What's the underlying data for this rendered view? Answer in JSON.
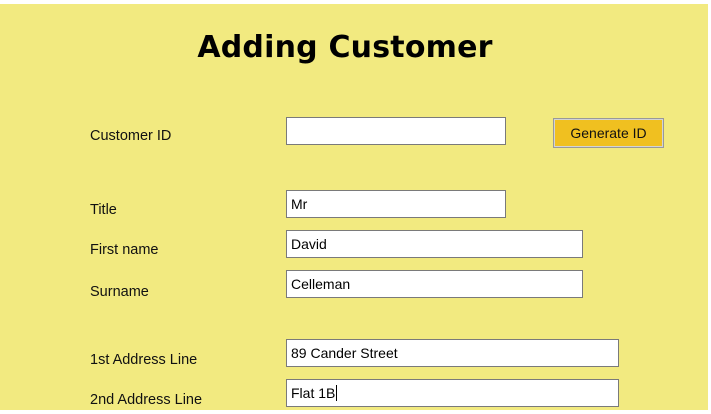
{
  "form": {
    "title": "Adding Customer",
    "generate_button_label": "Generate ID",
    "fields": {
      "customer_id": {
        "label": "Customer ID",
        "value": ""
      },
      "title": {
        "label": "Title",
        "value": "Mr"
      },
      "first_name": {
        "label": "First name",
        "value": "David"
      },
      "surname": {
        "label": "Surname",
        "value": "Celleman"
      },
      "address_line_1": {
        "label": "1st Address Line",
        "value": "89 Cander Street"
      },
      "address_line_2": {
        "label": "2nd Address Line",
        "value": "Flat 1B"
      }
    }
  },
  "colors": {
    "form_background": "#f2ea80",
    "button_background": "#f0c020"
  }
}
